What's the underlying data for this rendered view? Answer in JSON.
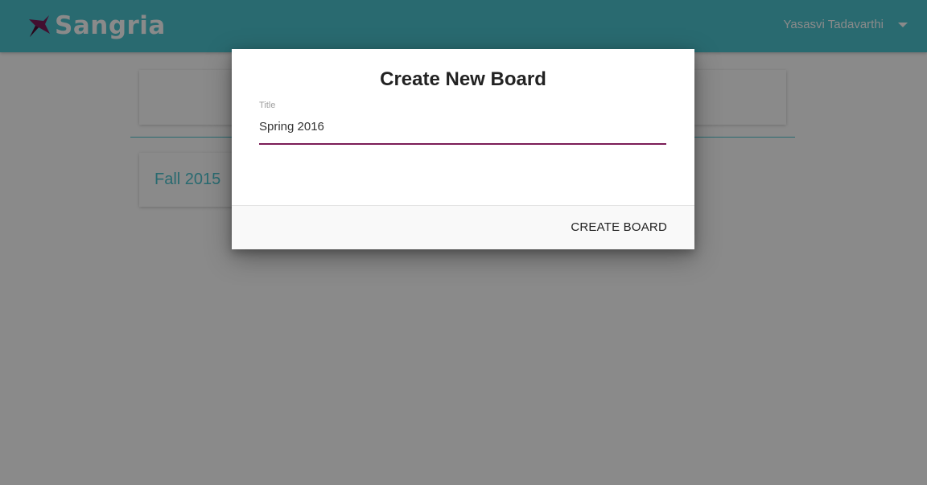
{
  "app": {
    "logo_text": "Sangria",
    "brand_color": "#4cc4cf",
    "accent_color": "#7b1d57",
    "logo_icon": "sangria-logo-icon"
  },
  "header": {
    "user_name": "Yasasvi Tadavarthi",
    "menu_icon": "caret-down-icon"
  },
  "boards": [
    {
      "title": "Fall 2015"
    }
  ],
  "dialog": {
    "title": "Create New Board",
    "field": {
      "label": "Title",
      "value": "Spring 2016"
    },
    "create_label": "CREATE BOARD"
  }
}
